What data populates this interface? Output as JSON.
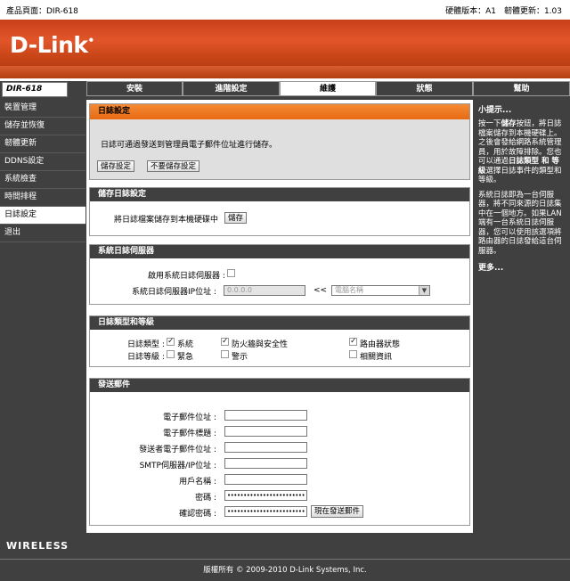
{
  "header": {
    "product_page": "產品頁面：DIR-618",
    "hw_fw": "硬體版本：A1　韌體更新：1.03",
    "brand": "D-Link"
  },
  "nav": {
    "model": "DIR-618",
    "tabs": [
      "安裝",
      "進階設定",
      "維護",
      "狀態",
      "幫助"
    ],
    "active_tab": "維護"
  },
  "sidebar": {
    "items": [
      "裝置管理",
      "儲存並恢復",
      "韌體更新",
      "DDNS設定",
      "系統檢查",
      "時間排程",
      "日誌設定",
      "退出"
    ],
    "active": "日誌設定"
  },
  "log_settings": {
    "title": "日誌設定",
    "description": "日誌可通過發送到管理員電子郵件位址進行儲存。",
    "save_btn": "儲存設定",
    "nosave_btn": "不要儲存設定"
  },
  "save_log": {
    "title": "儲存日誌設定",
    "label": "將日誌檔案儲存到本機硬碟中",
    "btn": "儲存"
  },
  "syslog": {
    "title": "系統日誌伺服器",
    "enable_label": "啟用系統日誌伺服器 :",
    "ip_label": "系統日誌伺服器IP位址 :",
    "ip_placeholder": "0.0.0.0",
    "arrow": "<<",
    "computer_name": "電腦名稱"
  },
  "log_type": {
    "title": "日誌類型和等級",
    "type_label": "日誌類型 :",
    "level_label": "日誌等級 :",
    "types": [
      {
        "label": "系統",
        "checked": true
      },
      {
        "label": "防火牆與安全性",
        "checked": true
      },
      {
        "label": "路由器狀態",
        "checked": true
      }
    ],
    "levels": [
      {
        "label": "緊急",
        "checked": false
      },
      {
        "label": "警示",
        "checked": false
      },
      {
        "label": "相關資訊",
        "checked": false
      }
    ]
  },
  "email": {
    "title": "發送郵件",
    "fields": [
      "電子郵件位址 :",
      "電子郵件標題 :",
      "發送者電子郵件位址 :",
      "SMTP伺服器/IP位址 :",
      "用戶名稱 :",
      "密碼 :",
      "確認密碼 :"
    ],
    "password_mask": "••••••••••••••••••••••••",
    "send_now_btn": "現在發送郵件"
  },
  "help": {
    "title": "小提示...",
    "p1_a": "按一下",
    "p1_b": "儲存",
    "p1_c": "按鈕，將日誌檔案儲存到本機硬碟上。之後會發給網路系統管理員，用於故障排除。您也可以通過",
    "p1_d": "日誌類型 和 等級",
    "p1_e": "選擇日誌事件的類型和等級。",
    "p2": "系統日誌即為一台伺服器，將不同來源的日誌集中在一個地方。如果LAN端有一台系統日誌伺服器，您可以使用該選項將路由器的日誌發給這台伺服器。",
    "more": "更多..."
  },
  "footer": {
    "wireless": "WIRELESS",
    "copyright": "版權所有 © 2009-2010 D-Link Systems, Inc."
  },
  "colors": {
    "banner": "#d24a1e",
    "accent_orange": "#f07a22",
    "dark_gray": "#404040"
  }
}
